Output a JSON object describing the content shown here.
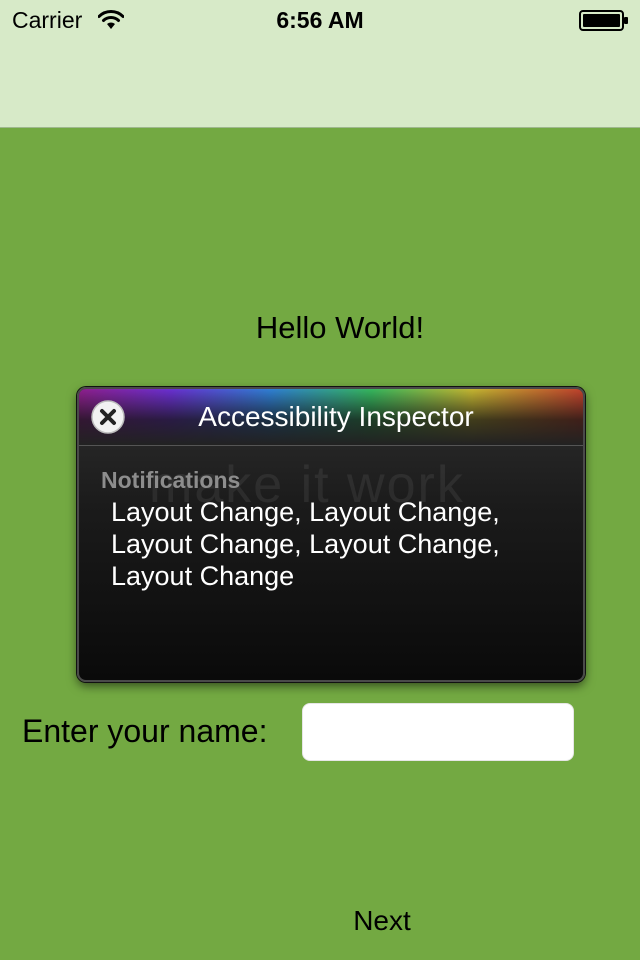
{
  "status_bar": {
    "carrier": "Carrier",
    "time": "6:56 AM"
  },
  "main": {
    "greeting": "Hello World!",
    "name_label": "Enter your name:",
    "name_value": "",
    "next_label": "Next"
  },
  "inspector": {
    "title": "Accessibility Inspector",
    "watermark": "make it work",
    "notifications_heading": "Notifications",
    "notifications_text": "Layout Change, Layout Change, Layout Change, Layout Change, Layout Change"
  },
  "colors": {
    "background": "#73a942",
    "top_area": "#d7eac8",
    "inspector_bg": "#0a0a0a"
  },
  "icons": [
    "wifi-icon",
    "battery-icon",
    "close-icon"
  ]
}
